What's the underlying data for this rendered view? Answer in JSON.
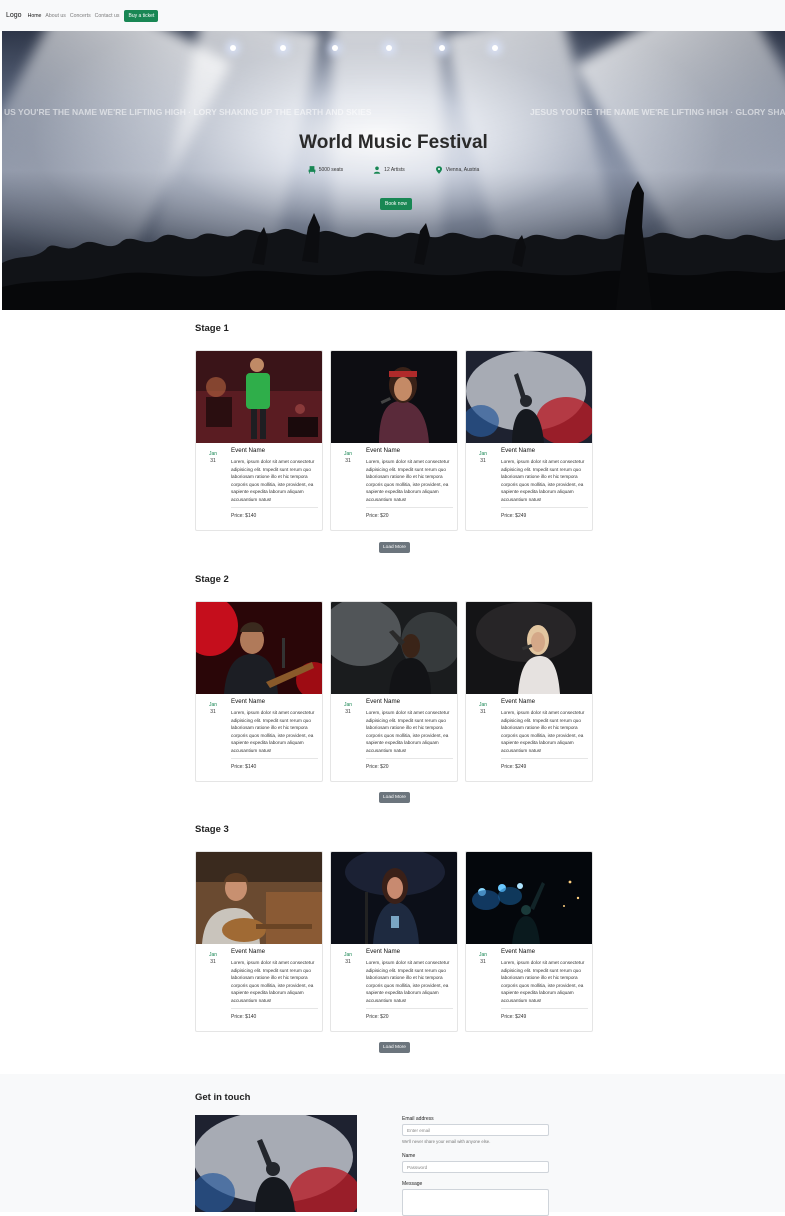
{
  "navbar": {
    "brand": "Logo",
    "links": [
      "Home",
      "About us",
      "Concerts",
      "Contact us"
    ],
    "cta": "Buy a ticket"
  },
  "hero": {
    "title": "World Music Festival",
    "stats": [
      {
        "icon": "seat-icon",
        "text": "5000 seats"
      },
      {
        "icon": "user-icon",
        "text": "12 Artists"
      },
      {
        "icon": "location-pin-icon",
        "text": "Vienna, Austria"
      }
    ],
    "book_label": "Book now",
    "screen_text_left": "US YOU'RE THE NAME WE'RE LIFTING HIGH · LORY SHAKING UP THE EARTH AND SKIES",
    "screen_text_right": "JESUS YOU'RE THE NAME WE'RE LIFTING HIGH · GLORY SHAKING UP THE EARTH AND SKIES"
  },
  "card_text": "Lorem, ipsum dolor sit amet consectetur adipisicing elit. Impedit sunt rerum quo laboriosam ratione illo et hic tempora corporis quos mollitia, iste provident, ea sapiente expedita laborum aliquam accusantium natus!",
  "stages": [
    {
      "title": "Stage 1",
      "load_more": "Load More",
      "events": [
        {
          "name": "Event Name",
          "month": "Jan",
          "day": "31",
          "price": "Price: $140",
          "photo": "singer-green-shirt-photo"
        },
        {
          "name": "Event Name",
          "month": "Jan",
          "day": "31",
          "price": "Price: $20",
          "photo": "singer-red-bandana-photo"
        },
        {
          "name": "Event Name",
          "month": "Jan",
          "day": "31",
          "price": "Price: $249",
          "photo": "performer-smoke-photo"
        }
      ]
    },
    {
      "title": "Stage 2",
      "load_more": "Load More",
      "events": [
        {
          "name": "Event Name",
          "month": "Jan",
          "day": "31",
          "price": "Price: $140",
          "photo": "guitarist-red-light-photo"
        },
        {
          "name": "Event Name",
          "month": "Jan",
          "day": "31",
          "price": "Price: $20",
          "photo": "singer-smoke-photo"
        },
        {
          "name": "Event Name",
          "month": "Jan",
          "day": "31",
          "price": "Price: $249",
          "photo": "singer-blonde-photo"
        }
      ]
    },
    {
      "title": "Stage 3",
      "load_more": "Load More",
      "events": [
        {
          "name": "Event Name",
          "month": "Jan",
          "day": "31",
          "price": "Price: $140",
          "photo": "acoustic-guitarist-photo"
        },
        {
          "name": "Event Name",
          "month": "Jan",
          "day": "31",
          "price": "Price: $20",
          "photo": "singer-dark-stage-photo"
        },
        {
          "name": "Event Name",
          "month": "Jan",
          "day": "31",
          "price": "Price: $249",
          "photo": "performer-blue-lights-photo"
        }
      ]
    }
  ],
  "contact": {
    "title": "Get in touch",
    "email_label": "Email address",
    "email_placeholder": "Enter email",
    "email_help": "We'll never share your email with anyone else.",
    "name_label": "Name",
    "name_placeholder": "Password",
    "message_label": "Message"
  },
  "colors": {
    "success": "#198754",
    "secondary": "#6c757d",
    "light_bg": "#f8f9fa"
  }
}
